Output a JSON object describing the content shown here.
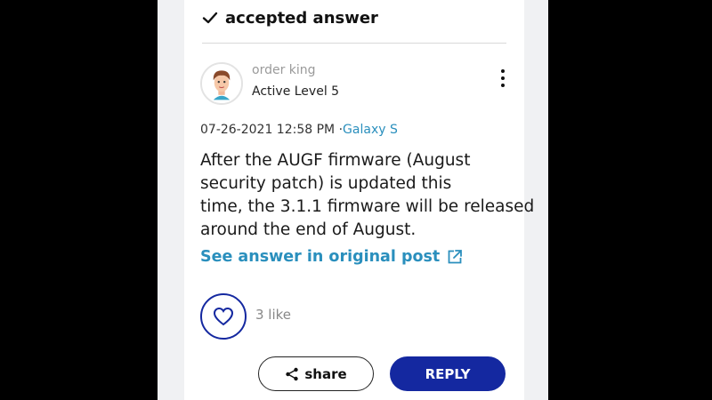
{
  "accepted": {
    "label": "accepted answer"
  },
  "author": {
    "name": "order king",
    "level": "Active Level 5"
  },
  "post": {
    "datetime": "07-26-2021 12:58 PM",
    "separator": "·",
    "category": "Galaxy S",
    "body_lines": [
      "After the AUGF firmware (August",
      "security patch) is updated this",
      "time, the 3.1.1 firmware will be released",
      "around the end of August."
    ],
    "see_answer_label": "See answer in original post"
  },
  "likes": {
    "count_label": "3 like"
  },
  "actions": {
    "share_label": "share",
    "reply_label": "REPLY"
  },
  "colors": {
    "accent_blue": "#1428a0",
    "link_blue": "#2a8fbd",
    "background": "#000000"
  },
  "icons": [
    "check-icon",
    "avatar",
    "more-vertical-icon",
    "external-link-icon",
    "heart-icon",
    "share-icon"
  ]
}
